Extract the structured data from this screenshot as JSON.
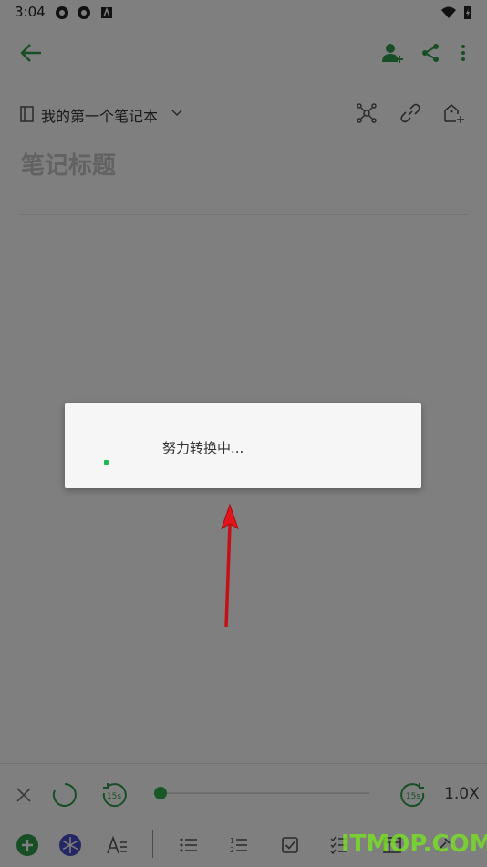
{
  "status_bar": {
    "time": "3:04"
  },
  "app_bar": {
    "back_icon": "arrow-left-icon",
    "actions": [
      "add-user-icon",
      "share-icon",
      "more-vert-icon"
    ]
  },
  "notebook": {
    "name": "我的第一个笔记本"
  },
  "note": {
    "title_placeholder": "笔记标题"
  },
  "audio_player": {
    "speed": "1.0X",
    "rewind_seconds": "15s",
    "forward_seconds": "15s",
    "progress": 0
  },
  "dialog": {
    "message": "努力转换中..."
  },
  "watermark": {
    "text": "ITMOP.COM"
  },
  "colors": {
    "accent": "#2e9c4a",
    "scrim": "rgba(0,0,0,0.5)",
    "dialog_bg": "#f6f6f6",
    "arrow": "#e0141a"
  }
}
